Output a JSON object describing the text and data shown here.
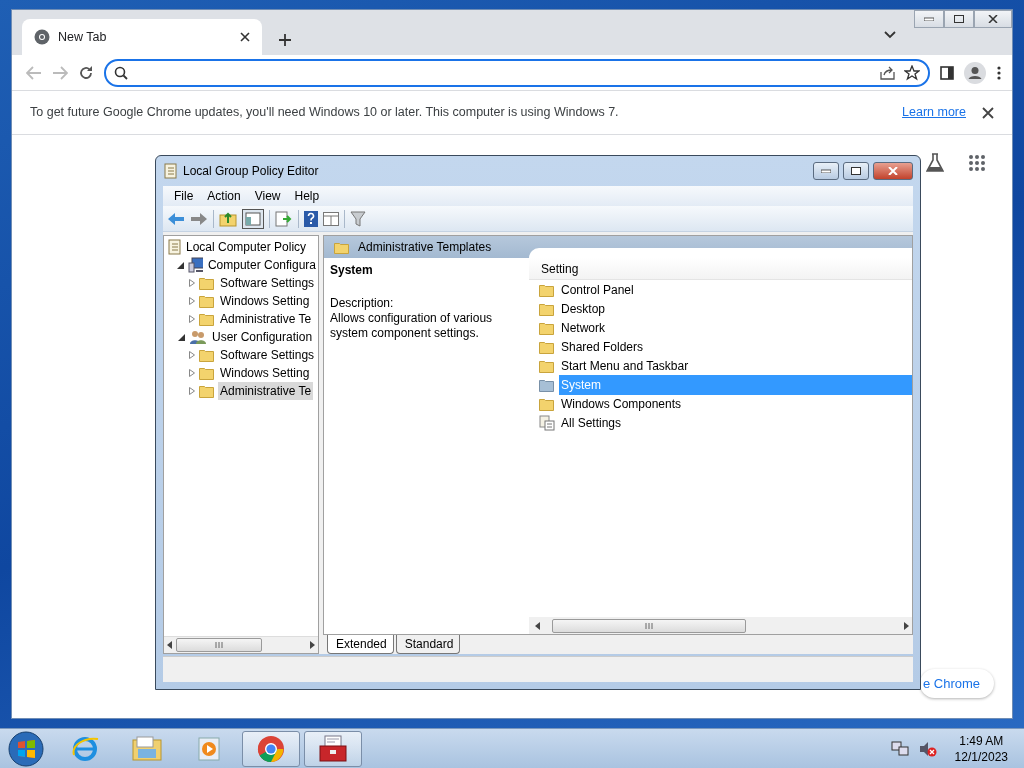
{
  "browser": {
    "tabs": [
      {
        "title": "New Tab",
        "selected": true
      }
    ],
    "infobar": {
      "message": "To get future Google Chrome updates, you'll need Windows 10 or later. This computer is using Windows 7.",
      "link": "Learn more"
    },
    "customize_button": {
      "label": "e Chrome"
    }
  },
  "gpedit": {
    "title": "Local Group Policy Editor",
    "menu": [
      "File",
      "Action",
      "View",
      "Help"
    ],
    "tree": [
      {
        "label": "Local Computer Policy",
        "kind": "policy",
        "selected": false,
        "children": [
          {
            "label": "Computer Configura",
            "kind": "computer",
            "expanded": true,
            "selected": false,
            "children": [
              {
                "label": "Software Settings",
                "kind": "folder",
                "expanded": false,
                "selected": false
              },
              {
                "label": "Windows Setting",
                "kind": "folder",
                "expanded": false,
                "selected": false
              },
              {
                "label": "Administrative Te",
                "kind": "folder",
                "expanded": false,
                "selected": false
              }
            ]
          },
          {
            "label": "User Configuration",
            "kind": "users",
            "expanded": true,
            "selected": false,
            "children": [
              {
                "label": "Software Settings",
                "kind": "folder",
                "expanded": false,
                "selected": false
              },
              {
                "label": "Windows Setting",
                "kind": "folder",
                "expanded": false,
                "selected": false
              },
              {
                "label": "Administrative Te",
                "kind": "folder",
                "expanded": false,
                "selected": true
              }
            ]
          }
        ]
      }
    ],
    "header": "Administrative Templates",
    "detail": {
      "title": "System",
      "description_label": "Description:",
      "description": "Allows configuration of various system component settings."
    },
    "column": "Setting",
    "items": [
      {
        "label": "Control Panel",
        "kind": "folder",
        "selected": false
      },
      {
        "label": "Desktop",
        "kind": "folder",
        "selected": false
      },
      {
        "label": "Network",
        "kind": "folder",
        "selected": false
      },
      {
        "label": "Shared Folders",
        "kind": "folder",
        "selected": false
      },
      {
        "label": "Start Menu and Taskbar",
        "kind": "folder",
        "selected": false
      },
      {
        "label": "System",
        "kind": "folder",
        "selected": true
      },
      {
        "label": "Windows Components",
        "kind": "folder",
        "selected": false
      },
      {
        "label": "All Settings",
        "kind": "settings",
        "selected": false
      }
    ],
    "view_tabs": [
      {
        "label": "Extended",
        "selected": true
      },
      {
        "label": "Standard",
        "selected": false
      }
    ]
  },
  "taskbar": {
    "apps": [
      {
        "kind": "ie",
        "running": false
      },
      {
        "kind": "explorer",
        "running": false
      },
      {
        "kind": "media",
        "running": false
      },
      {
        "kind": "chrome",
        "running": true
      },
      {
        "kind": "gpedit",
        "running": true
      }
    ],
    "time": "1:49 AM",
    "date": "12/1/2023"
  }
}
